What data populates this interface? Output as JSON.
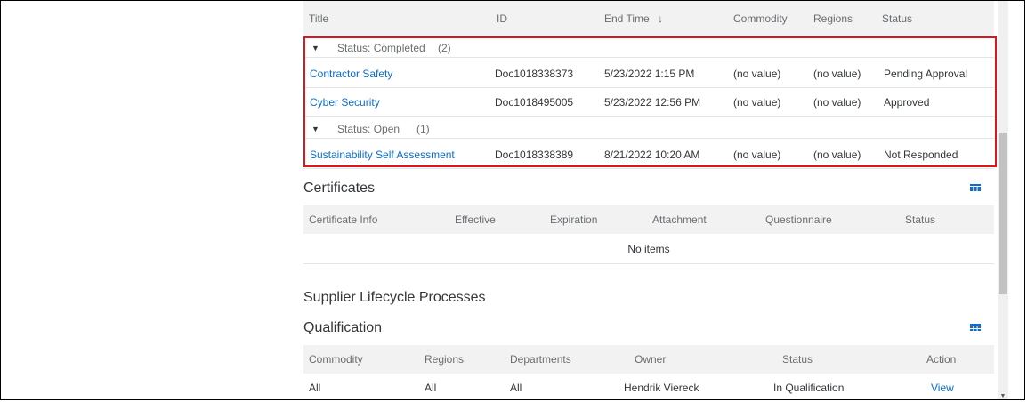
{
  "assessments_table": {
    "columns": [
      "Title",
      "ID",
      "End Time",
      "Commodity",
      "Regions",
      "Status"
    ],
    "sort_indicator": "↓",
    "groups": [
      {
        "label": "Status: Completed",
        "count": "(2)",
        "rows": [
          {
            "title": "Contractor Safety",
            "id": "Doc1018338373",
            "end_time": "5/23/2022 1:15 PM",
            "commodity": "(no value)",
            "regions": "(no value)",
            "status": "Pending Approval"
          },
          {
            "title": "Cyber Security",
            "id": "Doc1018495005",
            "end_time": "5/23/2022 12:56 PM",
            "commodity": "(no value)",
            "regions": "(no value)",
            "status": "Approved"
          }
        ]
      },
      {
        "label": "Status: Open",
        "count": "(1)",
        "rows": [
          {
            "title": "Sustainability Self Assessment",
            "id": "Doc1018338389",
            "end_time": "8/21/2022 10:20 AM",
            "commodity": "(no value)",
            "regions": "(no value)",
            "status": "Not Responded"
          }
        ]
      }
    ]
  },
  "certificates": {
    "title": "Certificates",
    "columns": [
      "Certificate Info",
      "Effective",
      "Expiration",
      "Attachment",
      "Questionnaire",
      "Status"
    ],
    "empty_text": "No items"
  },
  "lifecycle": {
    "title": "Supplier Lifecycle Processes"
  },
  "qualification": {
    "title": "Qualification",
    "columns": [
      "Commodity",
      "Regions",
      "Departments",
      "Owner",
      "Status",
      "Action"
    ],
    "rows": [
      {
        "commodity": "All",
        "regions": "All",
        "departments": "All",
        "owner": "Hendrik Viereck",
        "status": "In Qualification",
        "action": "View"
      }
    ]
  },
  "icons": {
    "group_expand": "triangle-down",
    "table_settings": "table-grid",
    "scroll_down": "triangle-down"
  },
  "colors": {
    "link": "#0a6ed1",
    "highlight": "#e0141e",
    "header_bg": "#f2f2f2"
  }
}
